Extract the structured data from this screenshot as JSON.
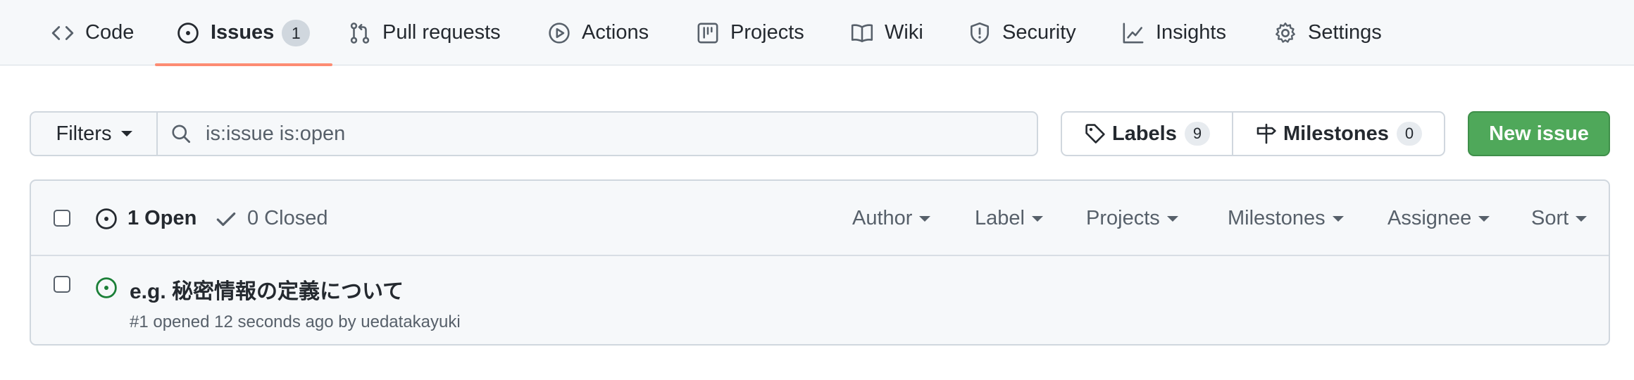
{
  "nav": {
    "tabs": [
      {
        "label": "Code",
        "icon": "code-icon"
      },
      {
        "label": "Issues",
        "icon": "issue-opened-icon",
        "count": "1",
        "selected": true
      },
      {
        "label": "Pull requests",
        "icon": "git-pull-request-icon"
      },
      {
        "label": "Actions",
        "icon": "play-icon"
      },
      {
        "label": "Projects",
        "icon": "table-icon"
      },
      {
        "label": "Wiki",
        "icon": "book-icon"
      },
      {
        "label": "Security",
        "icon": "shield-icon"
      },
      {
        "label": "Insights",
        "icon": "graph-icon"
      },
      {
        "label": "Settings",
        "icon": "gear-icon"
      }
    ],
    "accent_color": "#fd8c73"
  },
  "toolbar": {
    "filters_label": "Filters",
    "search_value": "is:issue is:open",
    "labels_label": "Labels",
    "labels_count": "9",
    "milestones_label": "Milestones",
    "milestones_count": "0",
    "new_issue_label": "New issue",
    "new_issue_color": "#4fa85a"
  },
  "list": {
    "open_label": "1 Open",
    "closed_label": "0 Closed",
    "filters": [
      "Author",
      "Label",
      "Projects",
      "Milestones",
      "Assignee",
      "Sort"
    ],
    "issues": [
      {
        "title": "e.g. 秘密情報の定義について",
        "meta_prefix": "#1 opened 12 seconds ago by ",
        "author": "uedatakayuki",
        "state_color": "#1a7f37"
      }
    ]
  }
}
